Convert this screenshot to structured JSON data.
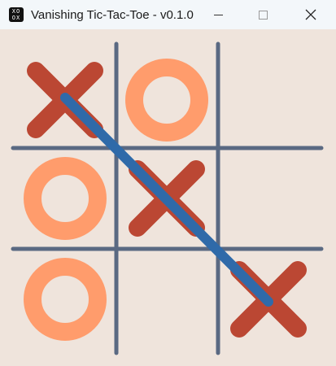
{
  "window": {
    "title": "Vanishing Tic-Tac-Toe - v0.1.0",
    "icon": "tic-tac-toe-app-icon",
    "icon_glyph_top": "XO",
    "icon_glyph_bottom": "OX",
    "controls": {
      "minimize": "minimize-icon",
      "maximize": "maximize-icon",
      "close": "close-icon"
    }
  },
  "board": {
    "size": 3,
    "cells": [
      [
        "X",
        "O",
        ""
      ],
      [
        "O",
        "X",
        ""
      ],
      [
        "O",
        "",
        "X"
      ]
    ],
    "winning_line": {
      "from": [
        0,
        0
      ],
      "to": [
        2,
        2
      ],
      "type": "diagonal"
    },
    "colors": {
      "x": "#bb4733",
      "o": "#ff9c6c",
      "grid": "#5a6982",
      "win_line": "#2f6aa9",
      "background": "#efe4dc"
    }
  }
}
